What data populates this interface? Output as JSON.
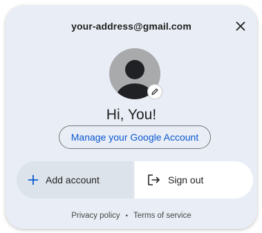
{
  "account": {
    "email": "your-address@gmail.com",
    "greeting": "Hi, You!"
  },
  "buttons": {
    "manage_label": "Manage your Google Account",
    "add_account_label": "Add account",
    "sign_out_label": "Sign out"
  },
  "footer": {
    "privacy_label": "Privacy policy",
    "separator": "•",
    "terms_label": "Terms of service"
  },
  "icons": {
    "close": "close-icon",
    "avatar": "default-profile-avatar",
    "edit": "pencil-icon",
    "add": "plus-icon",
    "sign_out": "sign-out-icon"
  },
  "colors": {
    "card_background": "#e9eef6",
    "accent": "#0b57d0",
    "add_account_background": "#dde3ea",
    "sign_out_background": "#ffffff",
    "avatar_background": "#a9aaac",
    "avatar_figure": "#202124"
  }
}
